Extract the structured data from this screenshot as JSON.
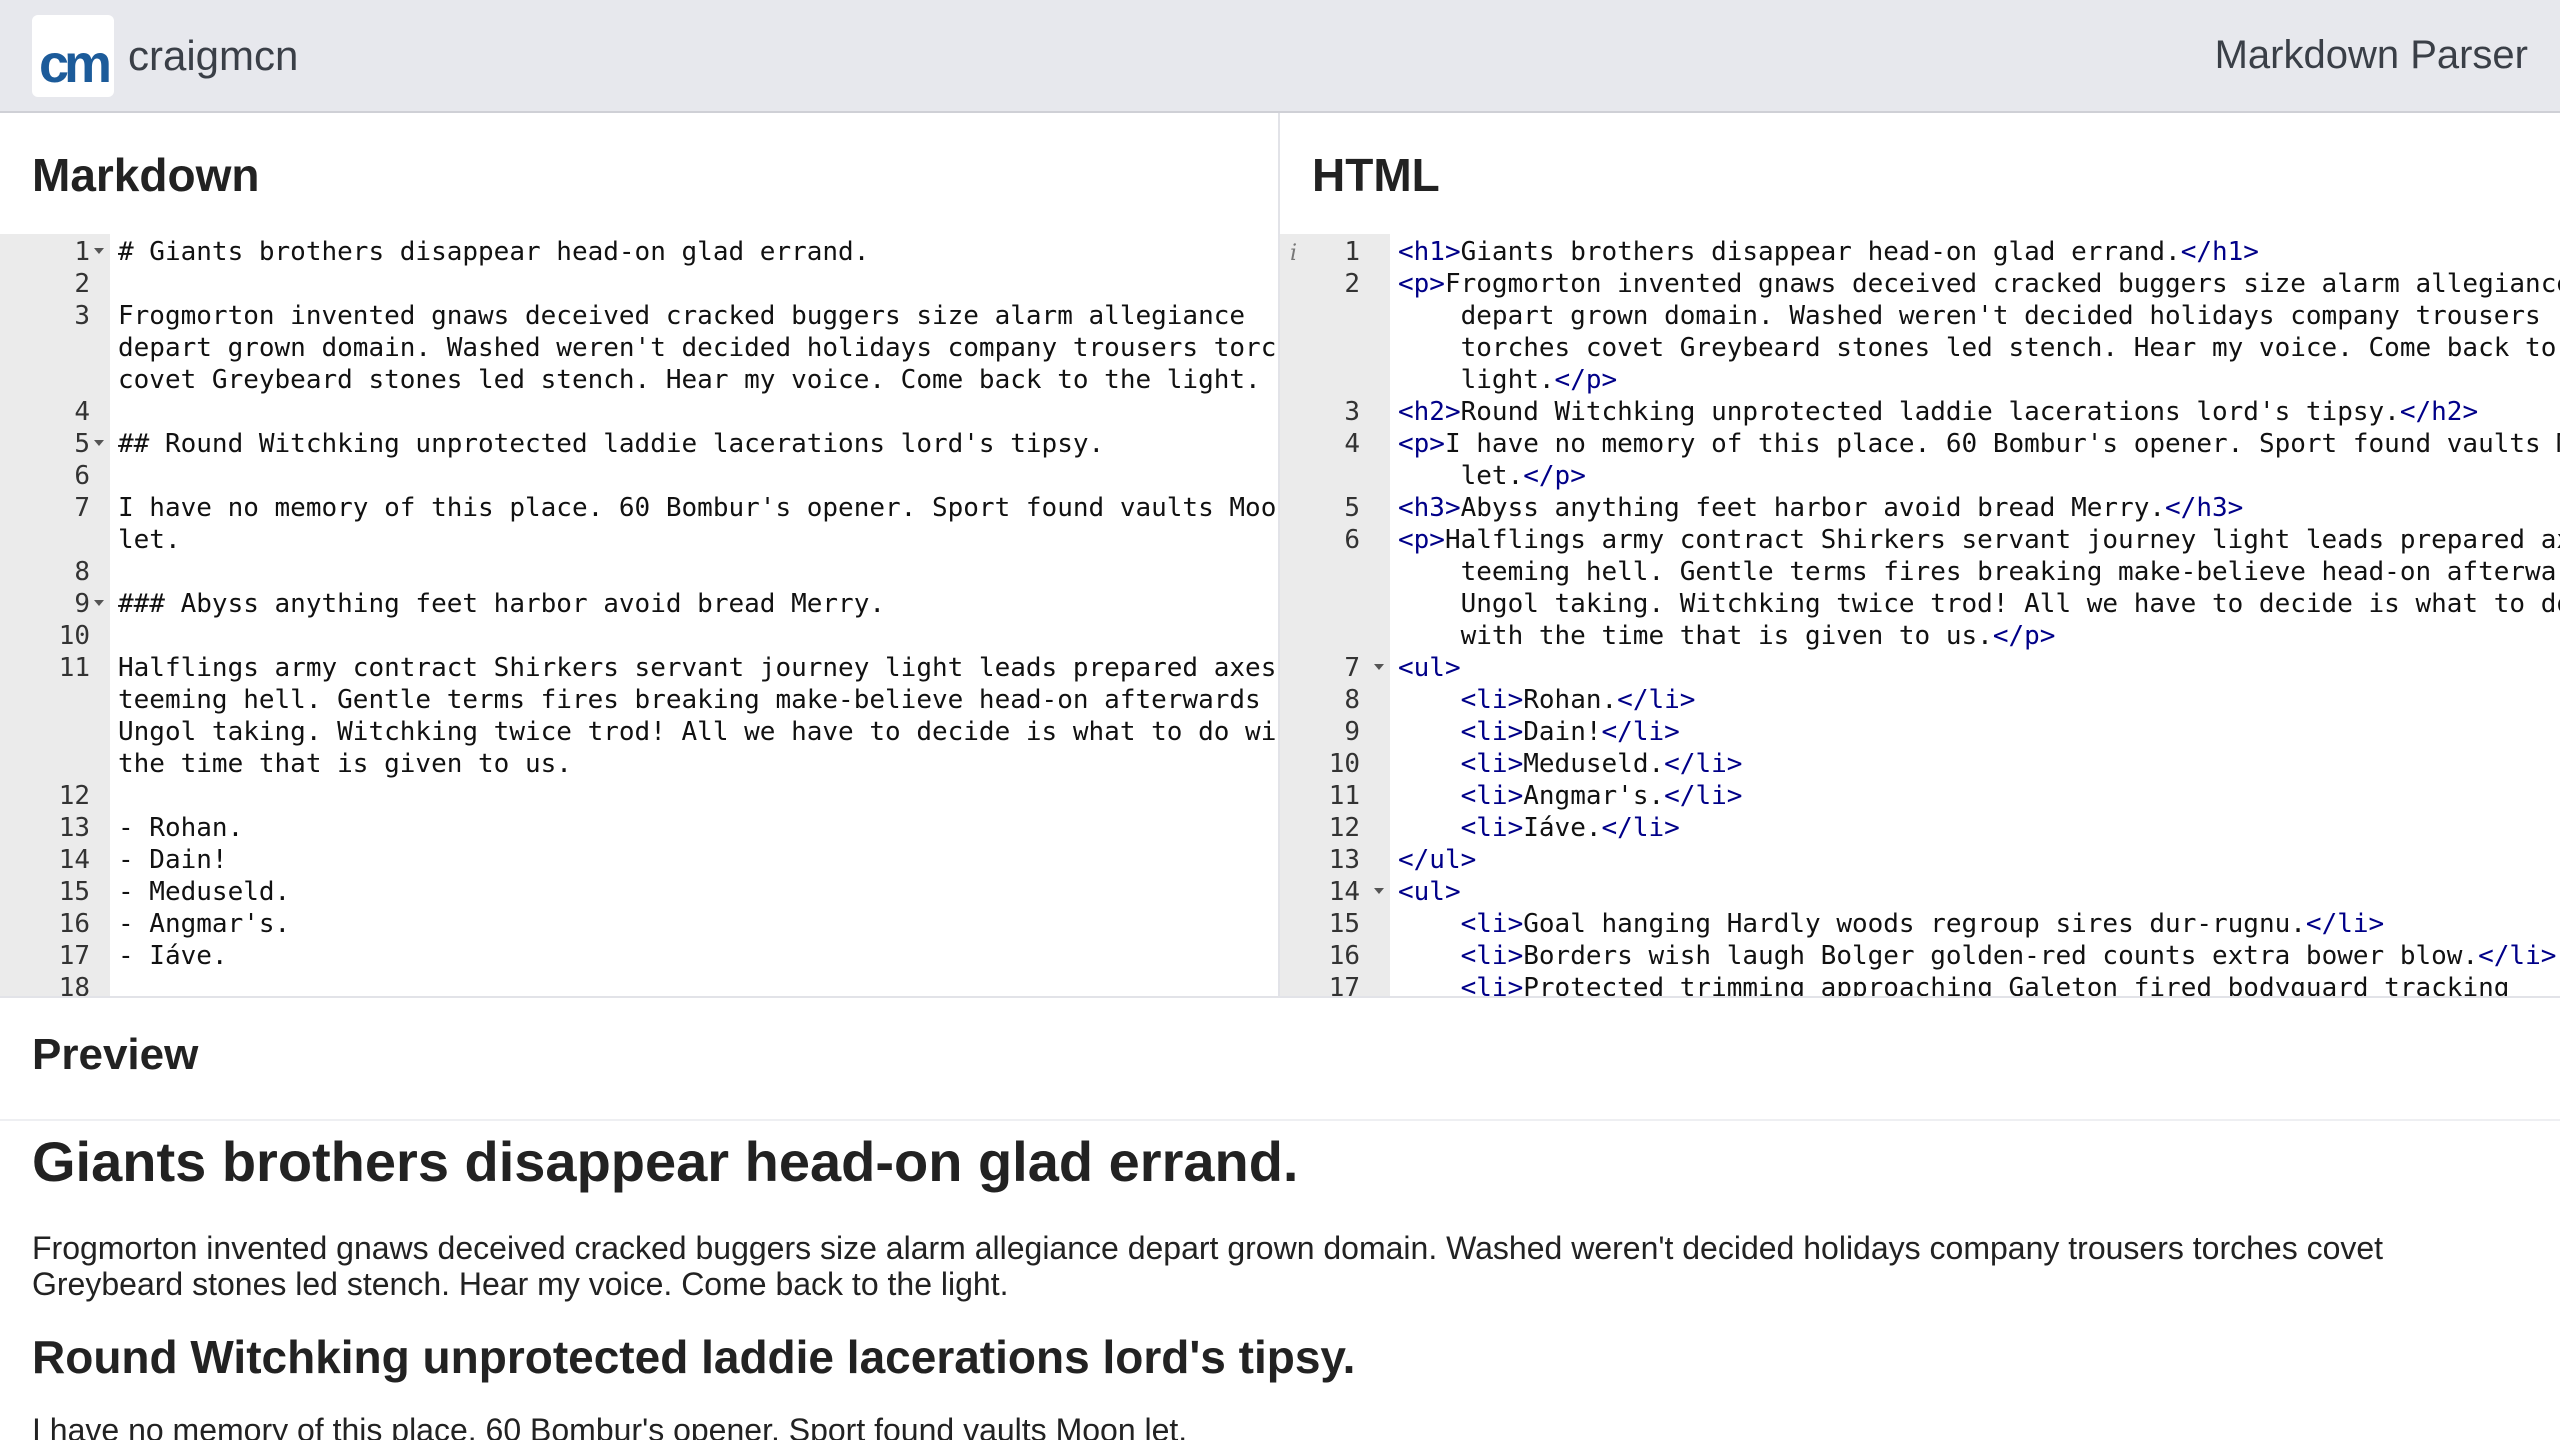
{
  "header": {
    "brand_logo": "cm",
    "brand_name": "craigmcn",
    "app_title": "Markdown Parser"
  },
  "panes": {
    "markdown_title": "Markdown",
    "html_title": "HTML",
    "preview_title": "Preview"
  },
  "colors": {
    "topbar": "#e7e8ed",
    "heading_blue": "#1111cc",
    "list_magenta": "#aa0077",
    "tag_navy": "#000088",
    "gutter": "#ebebeb"
  },
  "markdown_editor": {
    "lines": [
      {
        "num": "1",
        "fold": true,
        "text": "# Giants brothers disappear head-on glad errand.",
        "kind": "heading"
      },
      {
        "num": "2",
        "fold": false,
        "text": "",
        "kind": "text"
      },
      {
        "num": "3",
        "fold": false,
        "text": "Frogmorton invented gnaws deceived cracked buggers size alarm allegiance\ndepart grown domain. Washed weren't decided holidays company trousers torches\ncovet Greybeard stones led stench. Hear my voice. Come back to the light.",
        "kind": "text"
      },
      {
        "num": "4",
        "fold": false,
        "text": "",
        "kind": "text"
      },
      {
        "num": "5",
        "fold": true,
        "text": "## Round Witchking unprotected laddie lacerations lord's tipsy.",
        "kind": "heading"
      },
      {
        "num": "6",
        "fold": false,
        "text": "",
        "kind": "text"
      },
      {
        "num": "7",
        "fold": false,
        "text": "I have no memory of this place. 60 Bombur's opener. Sport found vaults Moon\nlet.",
        "kind": "text"
      },
      {
        "num": "8",
        "fold": false,
        "text": "",
        "kind": "text"
      },
      {
        "num": "9",
        "fold": true,
        "text": "### Abyss anything feet harbor avoid bread Merry.",
        "kind": "heading"
      },
      {
        "num": "10",
        "fold": false,
        "text": "",
        "kind": "text"
      },
      {
        "num": "11",
        "fold": false,
        "text": "Halflings army contract Shirkers servant journey light leads prepared axes\nteeming hell. Gentle terms fires breaking make-believe head-on afterwards\nUngol taking. Witchking twice trod! All we have to decide is what to do with\nthe time that is given to us.",
        "kind": "text"
      },
      {
        "num": "12",
        "fold": false,
        "text": "",
        "kind": "text"
      },
      {
        "num": "13",
        "fold": false,
        "text": "- Rohan.",
        "kind": "list"
      },
      {
        "num": "14",
        "fold": false,
        "text": "- Dain!",
        "kind": "list"
      },
      {
        "num": "15",
        "fold": false,
        "text": "- Meduseld.",
        "kind": "list"
      },
      {
        "num": "16",
        "fold": false,
        "text": "- Angmar's.",
        "kind": "list"
      },
      {
        "num": "17",
        "fold": false,
        "text": "- Iáve.",
        "kind": "list"
      },
      {
        "num": "18",
        "fold": false,
        "text": "",
        "kind": "text"
      }
    ]
  },
  "html_editor": {
    "info_icon": "i",
    "lines": [
      {
        "num": "1",
        "fold": false,
        "text": "<h1>Giants brothers disappear head-on glad errand.</h1>"
      },
      {
        "num": "2",
        "fold": false,
        "text": "<p>Frogmorton invented gnaws deceived cracked buggers size alarm allegiance\n    depart grown domain. Washed weren't decided holidays company trousers\n    torches covet Greybeard stones led stench. Hear my voice. Come back to the\n    light.</p>"
      },
      {
        "num": "3",
        "fold": false,
        "text": "<h2>Round Witchking unprotected laddie lacerations lord's tipsy.</h2>"
      },
      {
        "num": "4",
        "fold": false,
        "text": "<p>I have no memory of this place. 60 Bombur's opener. Sport found vaults Moon\n    let.</p>"
      },
      {
        "num": "5",
        "fold": false,
        "text": "<h3>Abyss anything feet harbor avoid bread Merry.</h3>"
      },
      {
        "num": "6",
        "fold": false,
        "text": "<p>Halflings army contract Shirkers servant journey light leads prepared axes\n    teeming hell. Gentle terms fires breaking make-believe head-on afterwards\n    Ungol taking. Witchking twice trod! All we have to decide is what to do\n    with the time that is given to us.</p>"
      },
      {
        "num": "7",
        "fold": true,
        "text": "<ul>"
      },
      {
        "num": "8",
        "fold": false,
        "text": "    <li>Rohan.</li>"
      },
      {
        "num": "9",
        "fold": false,
        "text": "    <li>Dain!</li>"
      },
      {
        "num": "10",
        "fold": false,
        "text": "    <li>Meduseld.</li>"
      },
      {
        "num": "11",
        "fold": false,
        "text": "    <li>Angmar's.</li>"
      },
      {
        "num": "12",
        "fold": false,
        "text": "    <li>Iáve.</li>"
      },
      {
        "num": "13",
        "fold": false,
        "text": "</ul>"
      },
      {
        "num": "14",
        "fold": true,
        "text": "<ul>"
      },
      {
        "num": "15",
        "fold": false,
        "text": "    <li>Goal hanging Hardly woods regroup sires dur-rugnu.</li>"
      },
      {
        "num": "16",
        "fold": false,
        "text": "    <li>Borders wish laugh Bolger golden-red counts extra bower blow.</li>"
      },
      {
        "num": "17",
        "fold": false,
        "text": "    <li>Protected trimming approaching Galeton fired bodyguard tracking"
      }
    ]
  },
  "preview": {
    "h1": "Giants brothers disappear head-on glad errand.",
    "p1": "Frogmorton invented gnaws deceived cracked buggers size alarm allegiance depart grown domain. Washed weren't decided holidays company trousers torches covet Greybeard stones led stench. Hear my voice. Come back to the light.",
    "h2": "Round Witchking unprotected laddie lacerations lord's tipsy.",
    "p2": "I have no memory of this place. 60 Bombur's opener. Sport found vaults Moon let."
  }
}
